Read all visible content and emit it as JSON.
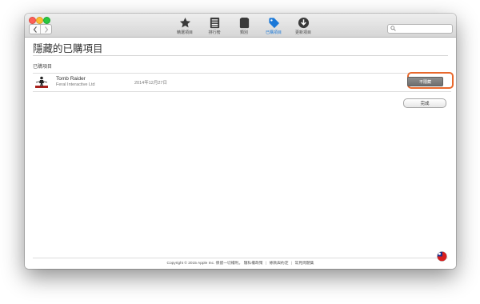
{
  "toolbar": {
    "tabs": [
      {
        "label": "精選項目",
        "icon": "star-icon",
        "active": false
      },
      {
        "label": "排行榜",
        "icon": "list-icon",
        "active": false
      },
      {
        "label": "類別",
        "icon": "categories-icon",
        "active": false
      },
      {
        "label": "已購項目",
        "icon": "tag-icon",
        "active": true
      },
      {
        "label": "更新項目",
        "icon": "download-icon",
        "active": false
      }
    ],
    "search": {
      "placeholder": ""
    },
    "accent_color": "#1a78d8"
  },
  "page": {
    "title": "隱藏的已購項目",
    "section_label": "已購項目"
  },
  "items": [
    {
      "name": "Tomb Raider",
      "developer": "Feral Interactive Ltd",
      "date": "2014年12月27日",
      "button_label": "不隱藏",
      "icon": "tomb-raider-app-icon"
    }
  ],
  "done_label": "完成",
  "highlight_color": "#e8692d",
  "footer": {
    "copyright": "Copyright © 2015 Apple Inc. 保留一切權利。",
    "links": [
      "隱私權政策",
      "條款與約定",
      "常見問題集"
    ]
  },
  "flag_icon": "taiwan-flag-icon"
}
